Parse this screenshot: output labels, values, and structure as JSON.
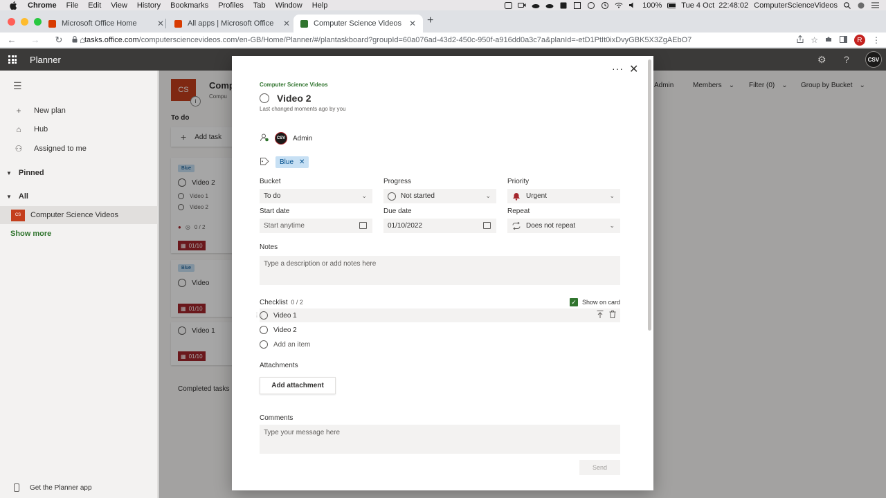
{
  "menubar": {
    "app": "Chrome",
    "items": [
      "File",
      "Edit",
      "View",
      "History",
      "Bookmarks",
      "Profiles",
      "Tab",
      "Window",
      "Help"
    ],
    "battery": "100%",
    "datetime": "Tue 4 Oct  22:48:02",
    "user": "ComputerScienceVideos"
  },
  "tabs": [
    {
      "title": "Microsoft Office Home",
      "color": "#d83b01"
    },
    {
      "title": "All apps | Microsoft Office",
      "color": "#d83b01"
    },
    {
      "title": "Computer Science Videos - Pla",
      "color": "#31752f"
    }
  ],
  "toolbar": {
    "url_host": "tasks.office.com",
    "url_path": "/computersciencevideos.com/en-GB/Home/Planner/#/plantaskboard?groupId=60a076ad-43d2-450c-950f-a916dd0a3c7a&planId=-etD1PtIt0ixDvyGBK5X3ZgAEbO7",
    "profile_initial": "R"
  },
  "suite": {
    "app_name": "Planner",
    "logo_text": "CSV"
  },
  "leftnav": {
    "items": [
      "New plan",
      "Hub",
      "Assigned to me"
    ],
    "pinned": "Pinned",
    "all": "All",
    "plan_icon": "CS",
    "plan_name": "Computer Science Videos",
    "show_more": "Show more",
    "get_app": "Get the Planner app"
  },
  "board": {
    "plan_icon": "CS",
    "plan_title": "Compu",
    "plan_sub": "Compu",
    "info_icon": "i",
    "filters": {
      "admin": "Admin",
      "members": "Members",
      "filter": "Filter (0)",
      "group": "Group by Bucket"
    },
    "bucket": "To do",
    "add_task": "Add task",
    "card1": {
      "label": "Blue",
      "title": "Video 2",
      "items": [
        "Video 1",
        "Video 2"
      ],
      "progress": "0 / 2",
      "due": "01/10"
    },
    "card2": {
      "label": "Blue",
      "title": "Video",
      "due": "01/10"
    },
    "card3": {
      "title": "Video 1",
      "due": "01/10"
    },
    "completed": "Completed tasks"
  },
  "modal": {
    "plan": "Computer Science Videos",
    "title": "Video 2",
    "changed": "Last changed moments ago by you",
    "assignee": "Admin",
    "assignee_avatar": "CSV",
    "label_chip": "Blue",
    "fields": {
      "bucket_label": "Bucket",
      "bucket_value": "To do",
      "progress_label": "Progress",
      "progress_value": "Not started",
      "priority_label": "Priority",
      "priority_value": "Urgent",
      "start_label": "Start date",
      "start_placeholder": "Start anytime",
      "due_label": "Due date",
      "due_value": "01/10/2022",
      "repeat_label": "Repeat",
      "repeat_value": "Does not repeat"
    },
    "notes_label": "Notes",
    "notes_placeholder": "Type a description or add notes here",
    "checklist_label": "Checklist",
    "checklist_count": "0 / 2",
    "show_on_card": "Show on card",
    "checklist_items": [
      "Video 1",
      "Video 2"
    ],
    "add_item": "Add an item",
    "attachments_label": "Attachments",
    "add_attachment": "Add attachment",
    "comments_label": "Comments",
    "comments_placeholder": "Type your message here",
    "send": "Send"
  },
  "colors": {
    "brand_green": "#31752f",
    "plan_orange": "#c43e1c",
    "urgent_red": "#a4262c",
    "label_blue": "#c7e0f4"
  }
}
